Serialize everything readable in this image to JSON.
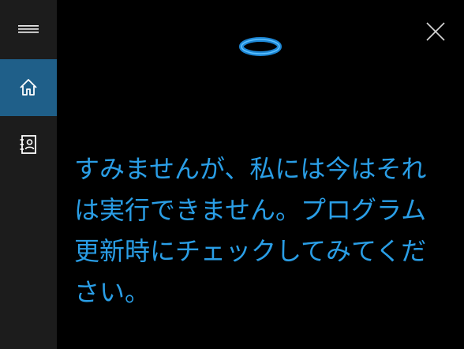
{
  "sidebar": {
    "menu_icon": "hamburger-menu-icon",
    "items": [
      {
        "id": "home",
        "icon": "home-icon",
        "selected": true
      },
      {
        "id": "notebook",
        "icon": "notebook-icon",
        "selected": false
      }
    ]
  },
  "main": {
    "close_icon": "close-icon",
    "cortana_icon": "cortana-ring-icon",
    "message": "すみませんが、私には今はそれは実行できません。プログラム更新時にチェックしてみてください。"
  },
  "colors": {
    "sidebar_bg": "#1c1c1c",
    "selected_bg": "#1f5f89",
    "main_bg": "#000000",
    "accent": "#2a9ee6",
    "icon": "#ffffff"
  }
}
